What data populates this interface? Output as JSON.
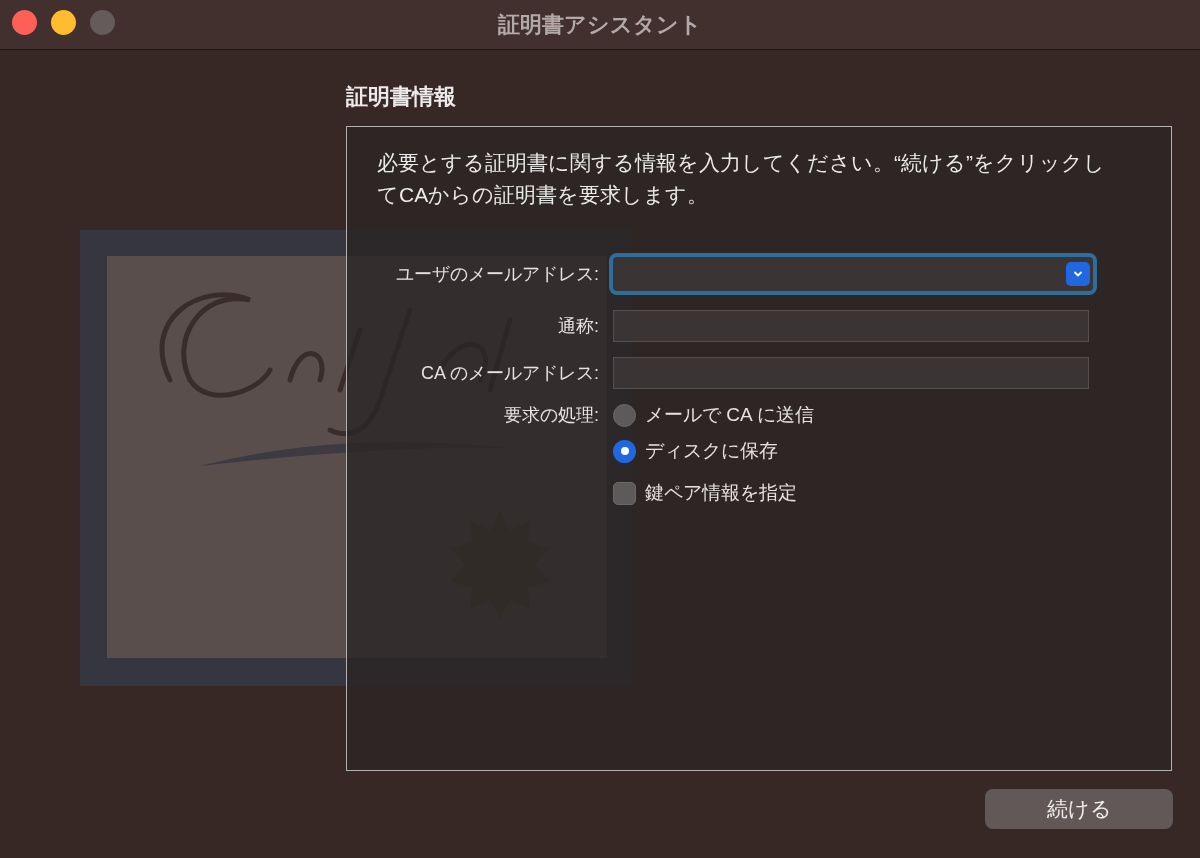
{
  "window": {
    "title": "証明書アシスタント"
  },
  "heading": "証明書情報",
  "instructions": "必要とする証明書に関する情報を入力してください。“続ける”をクリックしてCAからの証明書を要求します。",
  "fields": [
    {
      "label": "ユーザのメールアドレス:",
      "kind": "combo"
    },
    {
      "label": "通称:",
      "kind": "text"
    },
    {
      "label": "CA のメールアドレス:",
      "kind": "text"
    }
  ],
  "request": {
    "label": "要求の処理:",
    "options": [
      {
        "kind": "radio",
        "label": "メールで CA に送信",
        "selected": false
      },
      {
        "kind": "radio",
        "label": "ディスクに保存",
        "selected": true
      },
      {
        "kind": "checkbox",
        "label": "鍵ペア情報を指定",
        "checked": false
      }
    ]
  },
  "buttons": [
    {
      "label": "続ける"
    }
  ]
}
